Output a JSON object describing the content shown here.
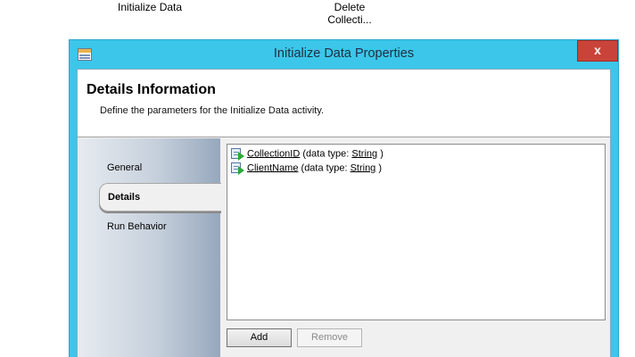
{
  "designer": {
    "initialize_label": "Initialize Data",
    "delete_label_line1": "Delete",
    "delete_label_line2": "Collecti..."
  },
  "dialog": {
    "title": "Initialize Data Properties",
    "close_glyph": "x",
    "icon": "properties-window-icon",
    "header": {
      "title": "Details Information",
      "subtitle": "Define the parameters for the Initialize Data activity."
    },
    "nav": {
      "items": [
        {
          "label": "General",
          "selected": false
        },
        {
          "label": "Details",
          "selected": true
        },
        {
          "label": "Run Behavior",
          "selected": false
        }
      ]
    },
    "parameters": [
      {
        "name": "CollectionID",
        "prefix": " (data type: ",
        "type": "String",
        "suffix": " )",
        "icon": "parameter-icon"
      },
      {
        "name": "ClientName",
        "prefix": " (data type: ",
        "type": "String",
        "suffix": " )",
        "icon": "parameter-icon"
      }
    ],
    "buttons": {
      "add_label": "Add",
      "remove_label": "Remove",
      "remove_enabled": false
    }
  },
  "colors": {
    "titlebar": "#3bc6ea",
    "close": "#c9433a",
    "param_arrow": "#2ea83a"
  }
}
